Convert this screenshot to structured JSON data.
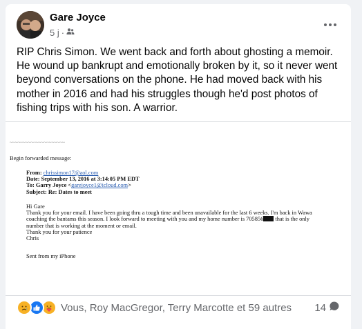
{
  "post": {
    "author": "Gare Joyce",
    "time": "5 j",
    "separator": "·",
    "text": "RIP Chris Simon. We went back and forth about ghosting a memoir. He wound up bankrupt and emotionally broken by it, so it never went beyond conversations on the phone. He had moved back with his mother in 2016 and had his struggles though he'd post photos of fishing trips with his son. A warrior."
  },
  "email": {
    "begin": "Begin forwarded message:",
    "from_label": "From:",
    "from_value": "chrissimon17@aol.com",
    "date_label": "Date:",
    "date_value": "September 13, 2016 at 3:14:05 PM EDT",
    "to_label": "To:",
    "to_name": "Garry Joyce <",
    "to_email": "garejoyce1@icloud.com",
    "to_end": ">",
    "subject_label": "Subject:",
    "subject_value": "Re: Dates to meet",
    "greeting": "Hi Gare",
    "line1": "Thank you for your email. I have been going thru a tough time and been unavailable for the last 6 weeks. I'm back in Wawa",
    "line2a": "coaching the bantams this season. I look forward to meeting with you and my home number is 705856",
    "line2b": " that is the only",
    "line3": "number that is working at the moment or email.",
    "thanks": "Thank you for your patience",
    "signoff": "Chris",
    "sent_from": "Sent from my iPhone"
  },
  "footer": {
    "reaction_names": "Vous, Roy MacGregor, Terry Marcotte et 59 autres",
    "comment_count": "14"
  },
  "icons": [
    "more-options-icon",
    "friends-audience-icon",
    "sad-reaction-icon",
    "like-reaction-icon",
    "care-reaction-icon",
    "comment-icon"
  ],
  "colors": {
    "like_blue": "#1877f2",
    "reaction_yellow": "#f7b125",
    "meta_gray": "#65676b"
  }
}
